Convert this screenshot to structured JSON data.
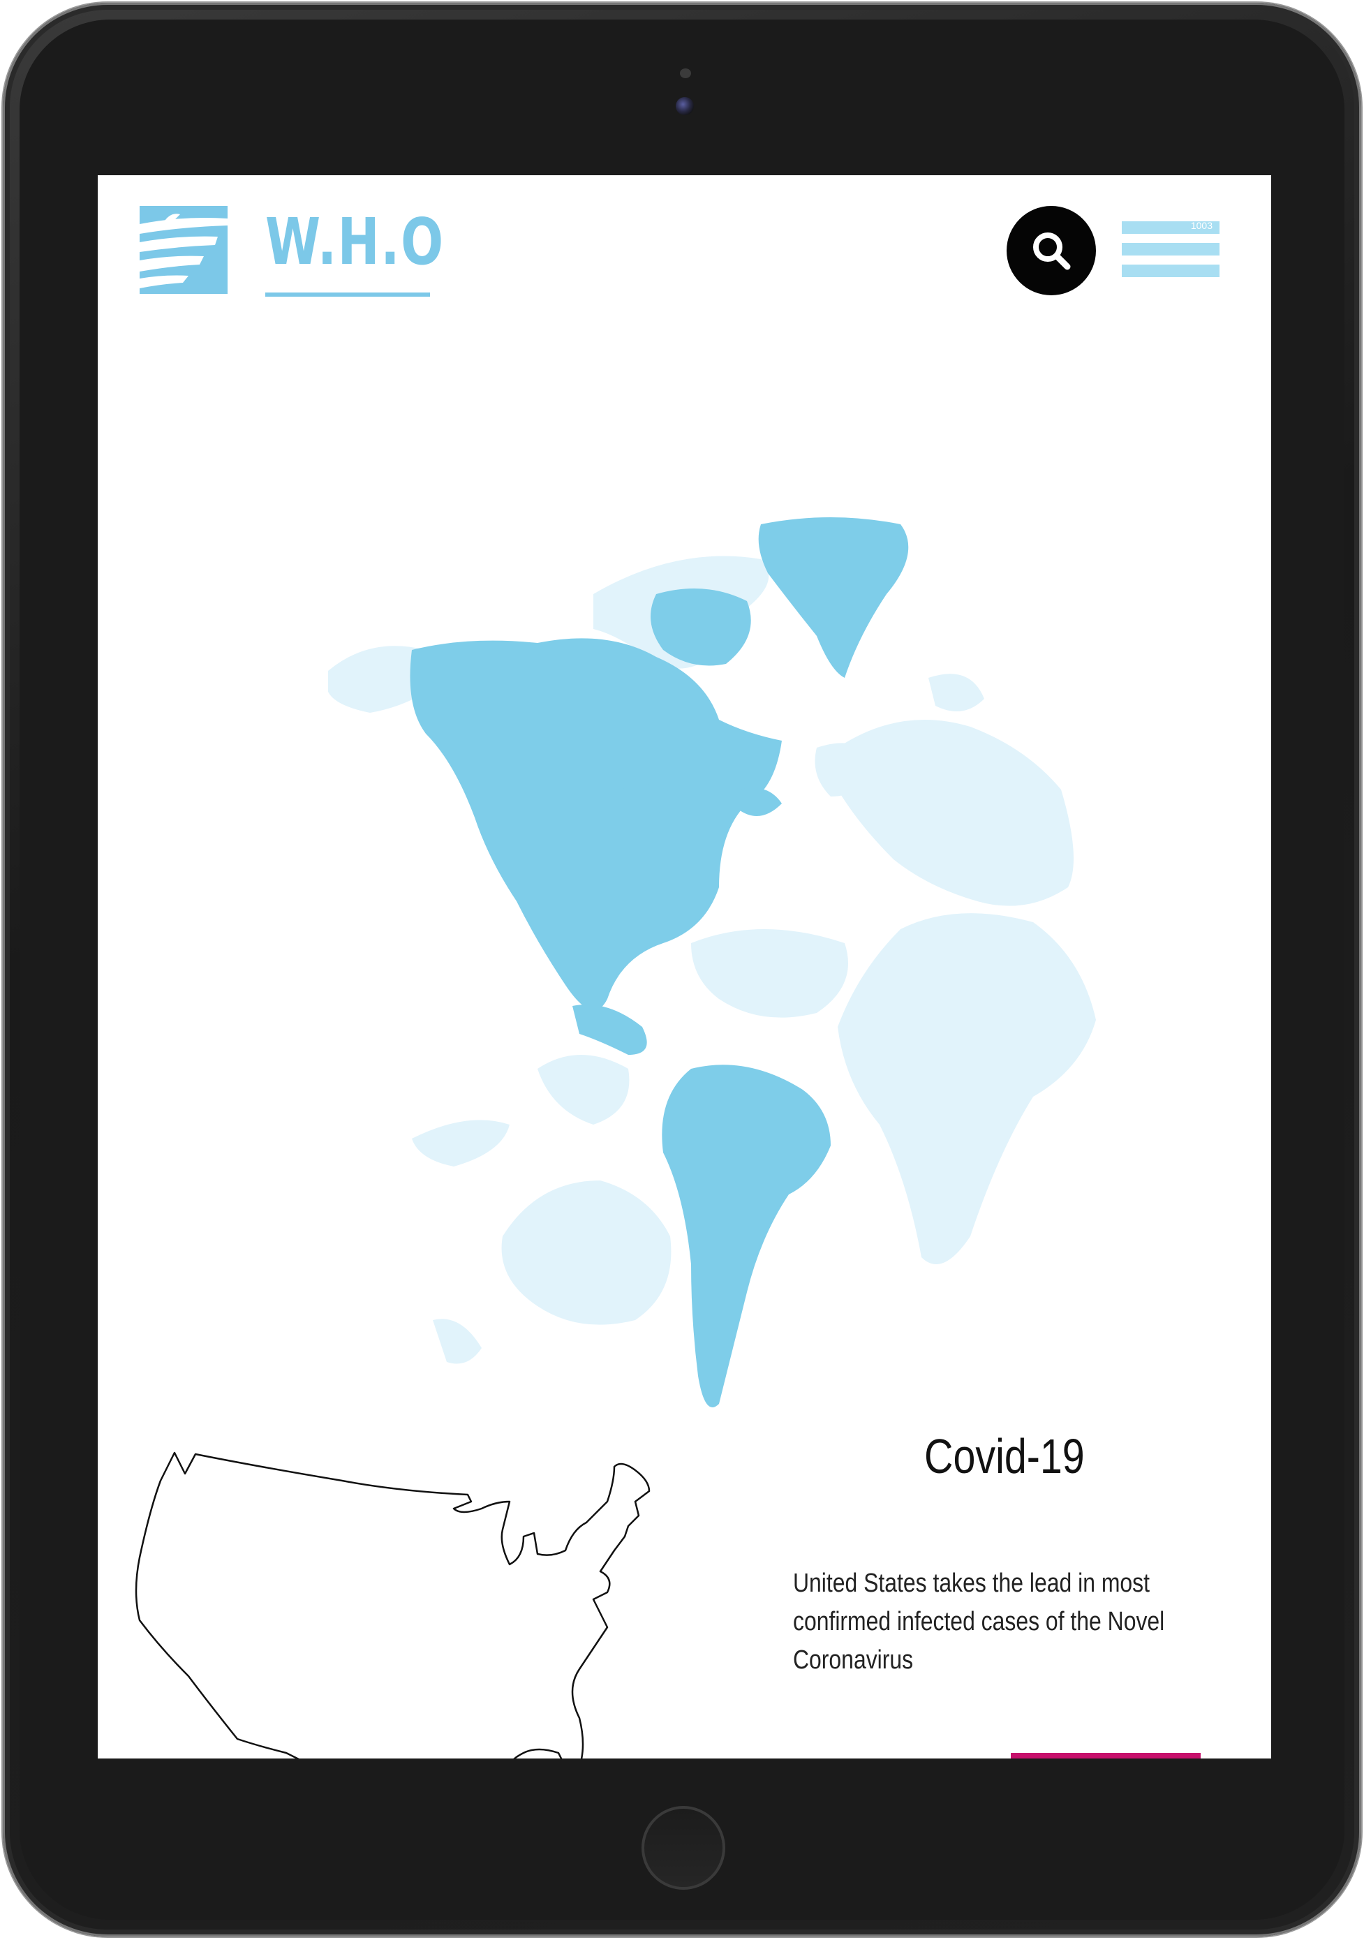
{
  "header": {
    "logo_text": "W.H.O",
    "logo_icon": "wing-logo-icon",
    "search_icon": "search-icon",
    "menu_icon": "hamburger-menu-icon",
    "menu_tag": "1003"
  },
  "hero": {
    "map_image": "world-map-americas-highlight",
    "highlight_color": "#7ecde9",
    "light_color": "#e1f3fb"
  },
  "article": {
    "title": "Covid-19",
    "description": "United States takes the lead in most confirmed infected cases of the Novel Coronavirus",
    "map_image": "united-states-outline",
    "button_color": "#c6106b"
  },
  "colors": {
    "brand": "#7cc8e8",
    "menu": "#a8def2",
    "search_bg": "#050505",
    "accent": "#c6106b"
  }
}
